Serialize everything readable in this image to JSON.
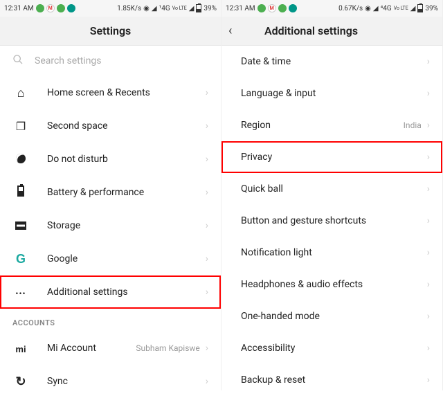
{
  "left": {
    "status": {
      "time": "12:31 AM",
      "speed": "1.85K/s",
      "net1": "¹4G",
      "net2": "Vo LTE",
      "battery": "39%"
    },
    "header": {
      "title": "Settings"
    },
    "search": {
      "placeholder": "Search settings"
    },
    "items": [
      {
        "icon": "i-home",
        "name": "home-screen-recents",
        "label": "Home screen & Recents"
      },
      {
        "icon": "i-stack",
        "name": "second-space",
        "label": "Second space"
      },
      {
        "icon": "i-moon",
        "name": "do-not-disturb",
        "label": "Do not disturb"
      },
      {
        "icon": "i-batt",
        "name": "battery-performance",
        "label": "Battery & performance"
      },
      {
        "icon": "i-storage",
        "name": "storage",
        "label": "Storage"
      },
      {
        "icon": "i-g",
        "name": "google",
        "label": "Google",
        "icon_text": "G"
      },
      {
        "icon": "i-dots",
        "name": "additional-settings",
        "label": "Additional settings",
        "highlight": true
      }
    ],
    "section_accounts": "ACCOUNTS",
    "accounts": [
      {
        "icon": "i-mi",
        "name": "mi-account",
        "label": "Mi Account",
        "value": "Subham Kapiswe",
        "icon_text": "mi"
      },
      {
        "icon": "i-sync",
        "name": "sync",
        "label": "Sync"
      }
    ]
  },
  "right": {
    "status": {
      "time": "12:31 AM",
      "speed": "0.67K/s",
      "net1": "⁴4G",
      "net2": "Vo LTE",
      "battery": "39%"
    },
    "header": {
      "title": "Additional settings"
    },
    "items": [
      {
        "name": "date-time",
        "label": "Date & time"
      },
      {
        "name": "language-input",
        "label": "Language & input"
      },
      {
        "name": "region",
        "label": "Region",
        "value": "India"
      },
      {
        "name": "privacy",
        "label": "Privacy",
        "highlight": true
      },
      {
        "name": "quick-ball",
        "label": "Quick ball"
      },
      {
        "name": "button-gesture",
        "label": "Button and gesture shortcuts"
      },
      {
        "name": "notification-light",
        "label": "Notification light"
      },
      {
        "name": "headphones-audio",
        "label": "Headphones & audio effects"
      },
      {
        "name": "one-handed",
        "label": "One-handed mode"
      },
      {
        "name": "accessibility",
        "label": "Accessibility"
      },
      {
        "name": "backup-reset",
        "label": "Backup & reset"
      }
    ]
  }
}
